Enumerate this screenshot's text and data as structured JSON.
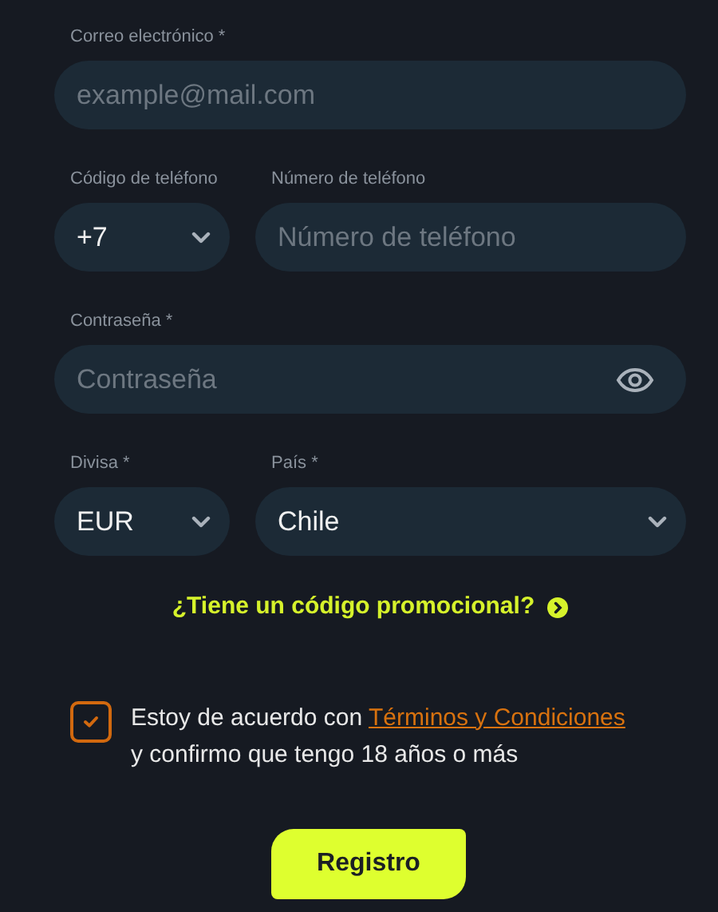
{
  "email": {
    "label": "Correo electrónico *",
    "placeholder": "example@mail.com"
  },
  "phone_code": {
    "label": "Código de teléfono",
    "value": "+7"
  },
  "phone_number": {
    "label": "Número de teléfono",
    "placeholder": "Número de teléfono"
  },
  "password": {
    "label": "Contraseña *",
    "placeholder": "Contraseña"
  },
  "currency": {
    "label": "Divisa *",
    "value": "EUR"
  },
  "country": {
    "label": "País *",
    "value": "Chile"
  },
  "promo_link": "¿Tiene un código promocional?",
  "agreement": {
    "checked": true,
    "text_before": "Estoy de acuerdo con ",
    "link": "Términos y Condiciones",
    "text_after": "y confirmo que tengo 18 años o más"
  },
  "submit_button": "Registro"
}
